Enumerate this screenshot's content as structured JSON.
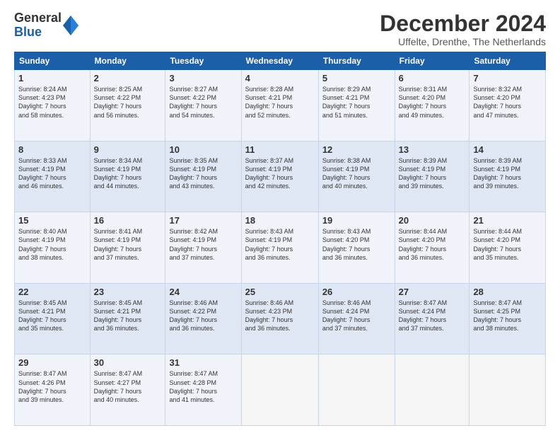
{
  "logo": {
    "line1": "General",
    "line2": "Blue"
  },
  "title": "December 2024",
  "subtitle": "Uffelte, Drenthe, The Netherlands",
  "days_header": [
    "Sunday",
    "Monday",
    "Tuesday",
    "Wednesday",
    "Thursday",
    "Friday",
    "Saturday"
  ],
  "weeks": [
    [
      {
        "day": "1",
        "lines": [
          "Sunrise: 8:24 AM",
          "Sunset: 4:23 PM",
          "Daylight: 7 hours",
          "and 58 minutes."
        ]
      },
      {
        "day": "2",
        "lines": [
          "Sunrise: 8:25 AM",
          "Sunset: 4:22 PM",
          "Daylight: 7 hours",
          "and 56 minutes."
        ]
      },
      {
        "day": "3",
        "lines": [
          "Sunrise: 8:27 AM",
          "Sunset: 4:22 PM",
          "Daylight: 7 hours",
          "and 54 minutes."
        ]
      },
      {
        "day": "4",
        "lines": [
          "Sunrise: 8:28 AM",
          "Sunset: 4:21 PM",
          "Daylight: 7 hours",
          "and 52 minutes."
        ]
      },
      {
        "day": "5",
        "lines": [
          "Sunrise: 8:29 AM",
          "Sunset: 4:21 PM",
          "Daylight: 7 hours",
          "and 51 minutes."
        ]
      },
      {
        "day": "6",
        "lines": [
          "Sunrise: 8:31 AM",
          "Sunset: 4:20 PM",
          "Daylight: 7 hours",
          "and 49 minutes."
        ]
      },
      {
        "day": "7",
        "lines": [
          "Sunrise: 8:32 AM",
          "Sunset: 4:20 PM",
          "Daylight: 7 hours",
          "and 47 minutes."
        ]
      }
    ],
    [
      {
        "day": "8",
        "lines": [
          "Sunrise: 8:33 AM",
          "Sunset: 4:19 PM",
          "Daylight: 7 hours",
          "and 46 minutes."
        ]
      },
      {
        "day": "9",
        "lines": [
          "Sunrise: 8:34 AM",
          "Sunset: 4:19 PM",
          "Daylight: 7 hours",
          "and 44 minutes."
        ]
      },
      {
        "day": "10",
        "lines": [
          "Sunrise: 8:35 AM",
          "Sunset: 4:19 PM",
          "Daylight: 7 hours",
          "and 43 minutes."
        ]
      },
      {
        "day": "11",
        "lines": [
          "Sunrise: 8:37 AM",
          "Sunset: 4:19 PM",
          "Daylight: 7 hours",
          "and 42 minutes."
        ]
      },
      {
        "day": "12",
        "lines": [
          "Sunrise: 8:38 AM",
          "Sunset: 4:19 PM",
          "Daylight: 7 hours",
          "and 40 minutes."
        ]
      },
      {
        "day": "13",
        "lines": [
          "Sunrise: 8:39 AM",
          "Sunset: 4:19 PM",
          "Daylight: 7 hours",
          "and 39 minutes."
        ]
      },
      {
        "day": "14",
        "lines": [
          "Sunrise: 8:39 AM",
          "Sunset: 4:19 PM",
          "Daylight: 7 hours",
          "and 39 minutes."
        ]
      }
    ],
    [
      {
        "day": "15",
        "lines": [
          "Sunrise: 8:40 AM",
          "Sunset: 4:19 PM",
          "Daylight: 7 hours",
          "and 38 minutes."
        ]
      },
      {
        "day": "16",
        "lines": [
          "Sunrise: 8:41 AM",
          "Sunset: 4:19 PM",
          "Daylight: 7 hours",
          "and 37 minutes."
        ]
      },
      {
        "day": "17",
        "lines": [
          "Sunrise: 8:42 AM",
          "Sunset: 4:19 PM",
          "Daylight: 7 hours",
          "and 37 minutes."
        ]
      },
      {
        "day": "18",
        "lines": [
          "Sunrise: 8:43 AM",
          "Sunset: 4:19 PM",
          "Daylight: 7 hours",
          "and 36 minutes."
        ]
      },
      {
        "day": "19",
        "lines": [
          "Sunrise: 8:43 AM",
          "Sunset: 4:20 PM",
          "Daylight: 7 hours",
          "and 36 minutes."
        ]
      },
      {
        "day": "20",
        "lines": [
          "Sunrise: 8:44 AM",
          "Sunset: 4:20 PM",
          "Daylight: 7 hours",
          "and 36 minutes."
        ]
      },
      {
        "day": "21",
        "lines": [
          "Sunrise: 8:44 AM",
          "Sunset: 4:20 PM",
          "Daylight: 7 hours",
          "and 35 minutes."
        ]
      }
    ],
    [
      {
        "day": "22",
        "lines": [
          "Sunrise: 8:45 AM",
          "Sunset: 4:21 PM",
          "Daylight: 7 hours",
          "and 35 minutes."
        ]
      },
      {
        "day": "23",
        "lines": [
          "Sunrise: 8:45 AM",
          "Sunset: 4:21 PM",
          "Daylight: 7 hours",
          "and 36 minutes."
        ]
      },
      {
        "day": "24",
        "lines": [
          "Sunrise: 8:46 AM",
          "Sunset: 4:22 PM",
          "Daylight: 7 hours",
          "and 36 minutes."
        ]
      },
      {
        "day": "25",
        "lines": [
          "Sunrise: 8:46 AM",
          "Sunset: 4:23 PM",
          "Daylight: 7 hours",
          "and 36 minutes."
        ]
      },
      {
        "day": "26",
        "lines": [
          "Sunrise: 8:46 AM",
          "Sunset: 4:24 PM",
          "Daylight: 7 hours",
          "and 37 minutes."
        ]
      },
      {
        "day": "27",
        "lines": [
          "Sunrise: 8:47 AM",
          "Sunset: 4:24 PM",
          "Daylight: 7 hours",
          "and 37 minutes."
        ]
      },
      {
        "day": "28",
        "lines": [
          "Sunrise: 8:47 AM",
          "Sunset: 4:25 PM",
          "Daylight: 7 hours",
          "and 38 minutes."
        ]
      }
    ],
    [
      {
        "day": "29",
        "lines": [
          "Sunrise: 8:47 AM",
          "Sunset: 4:26 PM",
          "Daylight: 7 hours",
          "and 39 minutes."
        ]
      },
      {
        "day": "30",
        "lines": [
          "Sunrise: 8:47 AM",
          "Sunset: 4:27 PM",
          "Daylight: 7 hours",
          "and 40 minutes."
        ]
      },
      {
        "day": "31",
        "lines": [
          "Sunrise: 8:47 AM",
          "Sunset: 4:28 PM",
          "Daylight: 7 hours",
          "and 41 minutes."
        ]
      },
      null,
      null,
      null,
      null
    ]
  ]
}
